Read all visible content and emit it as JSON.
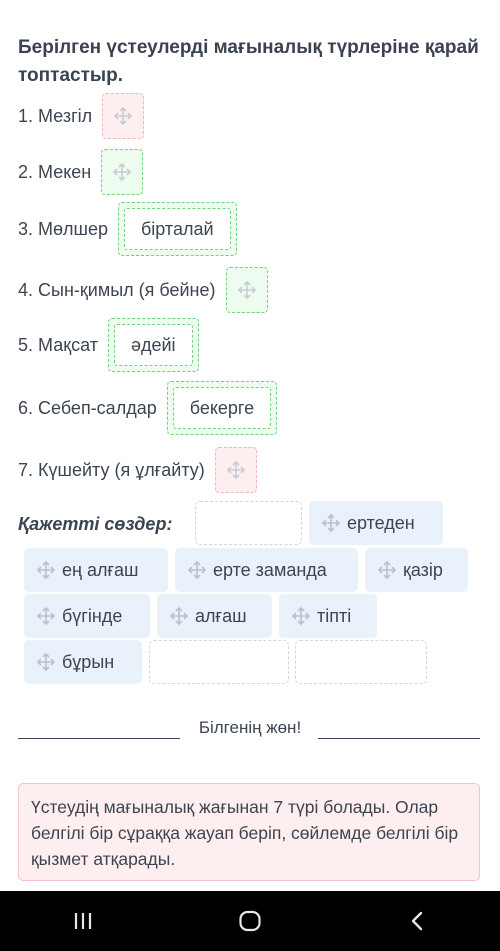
{
  "title": "Берілген үстеулерді мағыналық түрлеріне қарай топтастыр.",
  "categories": [
    {
      "label": "1. Мезгіл",
      "state": "empty-red",
      "value": ""
    },
    {
      "label": "2. Мекен",
      "state": "empty-green",
      "value": ""
    },
    {
      "label": "3. Мөлшер",
      "state": "filled",
      "value": "бірталай"
    },
    {
      "label": "4. Сын-қимыл (я бейне)",
      "state": "empty-green",
      "value": ""
    },
    {
      "label": "5. Мақсат",
      "state": "filled",
      "value": "әдейі"
    },
    {
      "label": "6. Себеп-салдар",
      "state": "filled",
      "value": "бекерге"
    },
    {
      "label": "7. Күшейту (я ұлғайту)",
      "state": "empty-red",
      "value": ""
    }
  ],
  "word_bank": {
    "label": "Қажетті сөздер:",
    "words": [
      "ертеден",
      "ең алғаш",
      "ерте заманда",
      "қазір",
      "бүгінде",
      "алғаш",
      "тіпті",
      "бұрын"
    ]
  },
  "feedback": {
    "text": "Білгенің жөн!"
  },
  "explanation": "Үстеудің мағыналық жағынан 7 түрі болады. Олар белгілі бір сұраққа жауап беріп, сөйлемде белгілі бір қызмет атқарады.",
  "icons": {
    "drag_handle": "move-icon",
    "nav": [
      "recent-apps-icon",
      "home-icon",
      "back-icon"
    ]
  },
  "colors": {
    "error_bg": "#fdeff0",
    "error_border": "#f3b6bd",
    "success_bg": "#eefbef",
    "success_border": "#6fd37d",
    "chip_bg": "#e9f1fb",
    "text": "#3c4551"
  }
}
